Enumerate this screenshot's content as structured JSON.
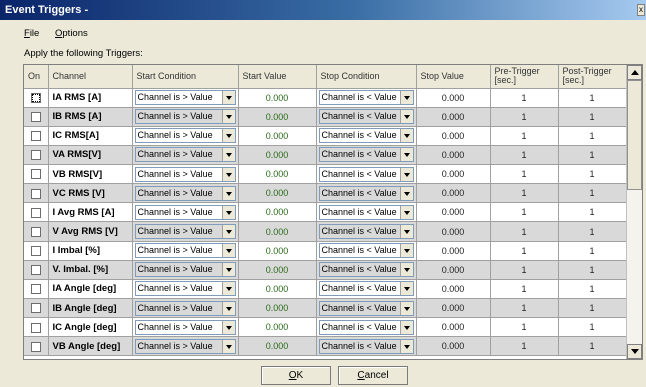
{
  "window": {
    "title": "Event Triggers -",
    "close_glyph": "x"
  },
  "menu": [
    {
      "accel": "F",
      "rest": "ile"
    },
    {
      "accel": "O",
      "rest": "ptions"
    }
  ],
  "section_label": "Apply the following Triggers:",
  "table": {
    "headers": [
      "On",
      "Channel",
      "Start Condition",
      "Start Value",
      "Stop Condition",
      "Stop Value",
      "Pre-Trigger [sec.]",
      "Post-Trigger [sec.]"
    ],
    "rows": [
      {
        "checked": false,
        "channel": "IA RMS [A]",
        "start_condition": "Channel is > Value",
        "start_value": "0.000",
        "stop_condition": "Channel is < Value",
        "stop_value": "0.000",
        "pre": "1",
        "post": "1"
      },
      {
        "checked": false,
        "channel": "IB RMS [A]",
        "start_condition": "Channel is > Value",
        "start_value": "0.000",
        "stop_condition": "Channel is < Value",
        "stop_value": "0.000",
        "pre": "1",
        "post": "1"
      },
      {
        "checked": false,
        "channel": "IC RMS[A]",
        "start_condition": "Channel is > Value",
        "start_value": "0.000",
        "stop_condition": "Channel is < Value",
        "stop_value": "0.000",
        "pre": "1",
        "post": "1"
      },
      {
        "checked": false,
        "channel": "VA RMS[V]",
        "start_condition": "Channel is > Value",
        "start_value": "0.000",
        "stop_condition": "Channel is < Value",
        "stop_value": "0.000",
        "pre": "1",
        "post": "1"
      },
      {
        "checked": false,
        "channel": "VB RMS[V]",
        "start_condition": "Channel is > Value",
        "start_value": "0.000",
        "stop_condition": "Channel is < Value",
        "stop_value": "0.000",
        "pre": "1",
        "post": "1"
      },
      {
        "checked": false,
        "channel": "VC RMS [V]",
        "start_condition": "Channel is > Value",
        "start_value": "0.000",
        "stop_condition": "Channel is < Value",
        "stop_value": "0.000",
        "pre": "1",
        "post": "1"
      },
      {
        "checked": false,
        "channel": "I Avg RMS [A]",
        "start_condition": "Channel is > Value",
        "start_value": "0.000",
        "stop_condition": "Channel is < Value",
        "stop_value": "0.000",
        "pre": "1",
        "post": "1"
      },
      {
        "checked": false,
        "channel": "V Avg RMS [V]",
        "start_condition": "Channel is > Value",
        "start_value": "0.000",
        "stop_condition": "Channel is < Value",
        "stop_value": "0.000",
        "pre": "1",
        "post": "1"
      },
      {
        "checked": false,
        "channel": "I Imbal [%]",
        "start_condition": "Channel is > Value",
        "start_value": "0.000",
        "stop_condition": "Channel is < Value",
        "stop_value": "0.000",
        "pre": "1",
        "post": "1"
      },
      {
        "checked": false,
        "channel": "V. Imbal. [%]",
        "start_condition": "Channel is > Value",
        "start_value": "0.000",
        "stop_condition": "Channel is < Value",
        "stop_value": "0.000",
        "pre": "1",
        "post": "1"
      },
      {
        "checked": false,
        "channel": "IA Angle [deg]",
        "start_condition": "Channel is > Value",
        "start_value": "0.000",
        "stop_condition": "Channel is < Value",
        "stop_value": "0.000",
        "pre": "1",
        "post": "1"
      },
      {
        "checked": false,
        "channel": "IB Angle [deg]",
        "start_condition": "Channel is > Value",
        "start_value": "0.000",
        "stop_condition": "Channel is < Value",
        "stop_value": "0.000",
        "pre": "1",
        "post": "1"
      },
      {
        "checked": false,
        "channel": "IC Angle [deg]",
        "start_condition": "Channel is > Value",
        "start_value": "0.000",
        "stop_condition": "Channel is < Value",
        "stop_value": "0.000",
        "pre": "1",
        "post": "1"
      },
      {
        "checked": false,
        "channel": "VB Angle [deg]",
        "start_condition": "Channel is > Value",
        "start_value": "0.000",
        "stop_condition": "Channel is < Value",
        "stop_value": "0.000",
        "pre": "1",
        "post": "1"
      }
    ]
  },
  "buttons": {
    "ok": {
      "accel": "O",
      "rest": "K"
    },
    "cancel": {
      "accel": "C",
      "rest": "ancel"
    }
  },
  "colors": {
    "start_value_text": "#2a6a1a",
    "title_gradient_start": "#0a246a",
    "row_alt": "#d9d9d9"
  }
}
